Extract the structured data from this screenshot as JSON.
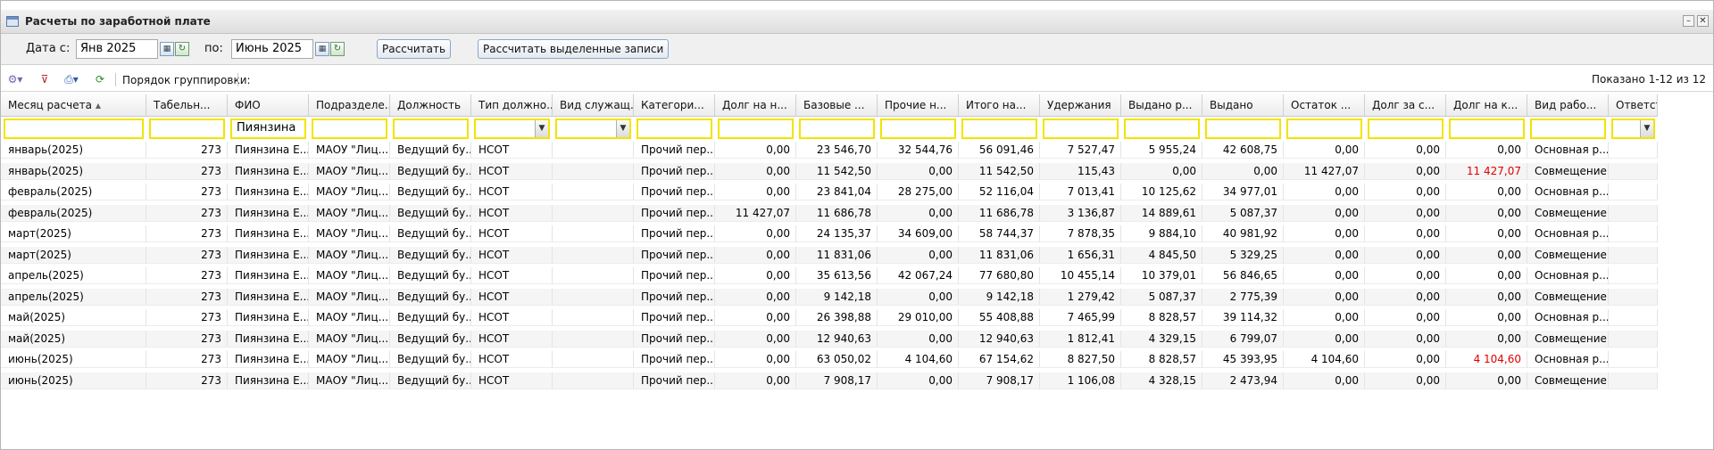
{
  "window": {
    "title": "Расчеты по заработной плате",
    "minimize_glyph": "–",
    "close_glyph": "✕"
  },
  "filters": {
    "date_from_label": "Дата с:",
    "date_from_value": "Янв 2025",
    "date_to_label": "по:",
    "date_to_value": "Июнь 2025",
    "calculate_button": "Рассчитать",
    "calculate_selected_button": "Рассчитать выделенные записи"
  },
  "toolbar": {
    "grouping_label": "Порядок группировки:",
    "shown_count": "Показано 1-12 из 12",
    "icons": [
      "add-menu-icon",
      "clear-filter-icon",
      "print-menu-icon",
      "refresh-icon"
    ]
  },
  "colors": {
    "filter_border": "#f2e400",
    "negative_debt": "#e00000"
  },
  "table": {
    "columns": [
      "Месяц расчета",
      "Табельн...",
      "ФИО",
      "Подразделе...",
      "Должность",
      "Тип должно...",
      "Вид служащ...",
      "Категори...",
      "Долг на н...",
      "Базовые ...",
      "Прочие н...",
      "Итого на...",
      "Удержания",
      "Выдано р...",
      "Выдано",
      "Остаток ...",
      "Долг за с...",
      "Долг на к...",
      "Вид рабо...",
      "Ответствен..."
    ],
    "filter_values": [
      "",
      "",
      "Пиянзина",
      "",
      "",
      "",
      "",
      "",
      "",
      "",
      "",
      "",
      "",
      "",
      "",
      "",
      "",
      "",
      "",
      ""
    ],
    "rows": [
      [
        "январь(2025)",
        "273",
        "Пиянзина Е...",
        "МАОУ \"Лиц...",
        "Ведущий бу...",
        "НСОТ",
        "",
        "Прочий пер...",
        "0,00",
        "23 546,70",
        "32 544,76",
        "56 091,46",
        "7 527,47",
        "5 955,24",
        "42 608,75",
        "0,00",
        "0,00",
        "0,00",
        "Основная р...",
        ""
      ],
      [
        "январь(2025)",
        "273",
        "Пиянзина Е...",
        "МАОУ \"Лиц...",
        "Ведущий бу...",
        "НСОТ",
        "",
        "Прочий пер...",
        "0,00",
        "11 542,50",
        "0,00",
        "11 542,50",
        "115,43",
        "0,00",
        "0,00",
        "11 427,07",
        "0,00",
        "11 427,07",
        "Совмещение",
        ""
      ],
      [
        "февраль(2025)",
        "273",
        "Пиянзина Е...",
        "МАОУ \"Лиц...",
        "Ведущий бу...",
        "НСОТ",
        "",
        "Прочий пер...",
        "0,00",
        "23 841,04",
        "28 275,00",
        "52 116,04",
        "7 013,41",
        "10 125,62",
        "34 977,01",
        "0,00",
        "0,00",
        "0,00",
        "Основная р...",
        ""
      ],
      [
        "февраль(2025)",
        "273",
        "Пиянзина Е...",
        "МАОУ \"Лиц...",
        "Ведущий бу...",
        "НСОТ",
        "",
        "Прочий пер...",
        "11 427,07",
        "11 686,78",
        "0,00",
        "11 686,78",
        "3 136,87",
        "14 889,61",
        "5 087,37",
        "0,00",
        "0,00",
        "0,00",
        "Совмещение",
        ""
      ],
      [
        "март(2025)",
        "273",
        "Пиянзина Е...",
        "МАОУ \"Лиц...",
        "Ведущий бу...",
        "НСОТ",
        "",
        "Прочий пер...",
        "0,00",
        "24 135,37",
        "34 609,00",
        "58 744,37",
        "7 878,35",
        "9 884,10",
        "40 981,92",
        "0,00",
        "0,00",
        "0,00",
        "Основная р...",
        ""
      ],
      [
        "март(2025)",
        "273",
        "Пиянзина Е...",
        "МАОУ \"Лиц...",
        "Ведущий бу...",
        "НСОТ",
        "",
        "Прочий пер...",
        "0,00",
        "11 831,06",
        "0,00",
        "11 831,06",
        "1 656,31",
        "4 845,50",
        "5 329,25",
        "0,00",
        "0,00",
        "0,00",
        "Совмещение",
        ""
      ],
      [
        "апрель(2025)",
        "273",
        "Пиянзина Е...",
        "МАОУ \"Лиц...",
        "Ведущий бу...",
        "НСОТ",
        "",
        "Прочий пер...",
        "0,00",
        "35 613,56",
        "42 067,24",
        "77 680,80",
        "10 455,14",
        "10 379,01",
        "56 846,65",
        "0,00",
        "0,00",
        "0,00",
        "Основная р...",
        ""
      ],
      [
        "апрель(2025)",
        "273",
        "Пиянзина Е...",
        "МАОУ \"Лиц...",
        "Ведущий бу...",
        "НСОТ",
        "",
        "Прочий пер...",
        "0,00",
        "9 142,18",
        "0,00",
        "9 142,18",
        "1 279,42",
        "5 087,37",
        "2 775,39",
        "0,00",
        "0,00",
        "0,00",
        "Совмещение",
        ""
      ],
      [
        "май(2025)",
        "273",
        "Пиянзина Е...",
        "МАОУ \"Лиц...",
        "Ведущий бу...",
        "НСОТ",
        "",
        "Прочий пер...",
        "0,00",
        "26 398,88",
        "29 010,00",
        "55 408,88",
        "7 465,99",
        "8 828,57",
        "39 114,32",
        "0,00",
        "0,00",
        "0,00",
        "Основная р...",
        ""
      ],
      [
        "май(2025)",
        "273",
        "Пиянзина Е...",
        "МАОУ \"Лиц...",
        "Ведущий бу...",
        "НСОТ",
        "",
        "Прочий пер...",
        "0,00",
        "12 940,63",
        "0,00",
        "12 940,63",
        "1 812,41",
        "4 329,15",
        "6 799,07",
        "0,00",
        "0,00",
        "0,00",
        "Совмещение",
        ""
      ],
      [
        "июнь(2025)",
        "273",
        "Пиянзина Е...",
        "МАОУ \"Лиц...",
        "Ведущий бу...",
        "НСОТ",
        "",
        "Прочий пер...",
        "0,00",
        "63 050,02",
        "4 104,60",
        "67 154,62",
        "8 827,50",
        "8 828,57",
        "45 393,95",
        "4 104,60",
        "0,00",
        "4 104,60",
        "Основная р...",
        ""
      ],
      [
        "июнь(2025)",
        "273",
        "Пиянзина Е...",
        "МАОУ \"Лиц...",
        "Ведущий бу...",
        "НСОТ",
        "",
        "Прочий пер...",
        "0,00",
        "7 908,17",
        "0,00",
        "7 908,17",
        "1 106,08",
        "4 328,15",
        "2 473,94",
        "0,00",
        "0,00",
        "0,00",
        "Совмещение",
        ""
      ]
    ]
  }
}
